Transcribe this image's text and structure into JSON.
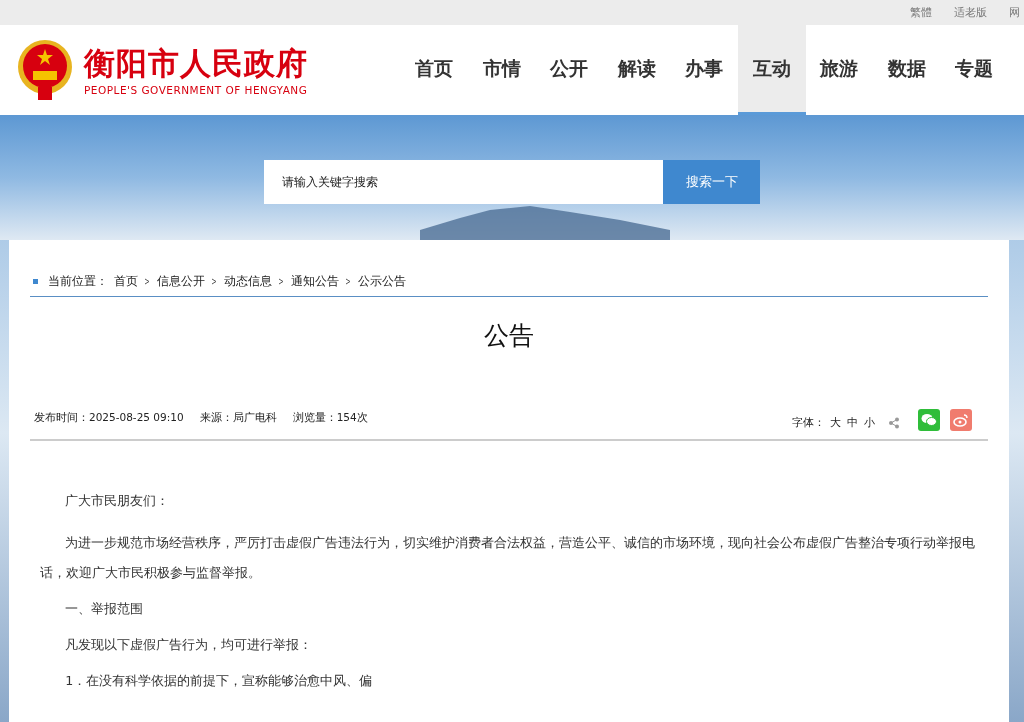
{
  "top_links": [
    "繁體",
    "适老版",
    "网"
  ],
  "site": {
    "title": "衡阳市人民政府",
    "subtitle": "PEOPLE'S GOVERNMENT OF HENGYANG"
  },
  "nav": [
    {
      "label": "首页",
      "selected": false
    },
    {
      "label": "市情",
      "selected": false
    },
    {
      "label": "公开",
      "selected": false
    },
    {
      "label": "解读",
      "selected": false
    },
    {
      "label": "办事",
      "selected": false
    },
    {
      "label": "互动",
      "selected": true
    },
    {
      "label": "旅游",
      "selected": false
    },
    {
      "label": "数据",
      "selected": false
    },
    {
      "label": "专题",
      "selected": false
    }
  ],
  "search": {
    "placeholder": "请输入关键字搜索",
    "button": "搜索一下"
  },
  "breadcrumb": {
    "label": "当前位置：",
    "items": [
      "首页",
      "信息公开",
      "动态信息",
      "通知公告",
      "公示公告"
    ]
  },
  "article": {
    "title": "公告",
    "meta": [
      "发布时间：2025-08-25 09:10",
      "来源：局广电科",
      "浏览量：154次"
    ],
    "font_label": "字体：",
    "font_sizes": [
      "大",
      "中",
      "小"
    ],
    "paragraphs": [
      "广大市民朋友们：",
      "为进一步规范市场经营秩序，严厉打击虚假广告违法行为，切实维护消费者合法权益，营造公平、诚信的市场环境，现向社会公布虚假广告整治专项行动举报电话，欢迎广大市民积极参与监督举报。",
      "一、举报范围",
      "凡发现以下虚假广告行为，均可进行举报：",
      "1．在没有科学依据的前提下，宣称能够治愈中风、偏"
    ]
  }
}
